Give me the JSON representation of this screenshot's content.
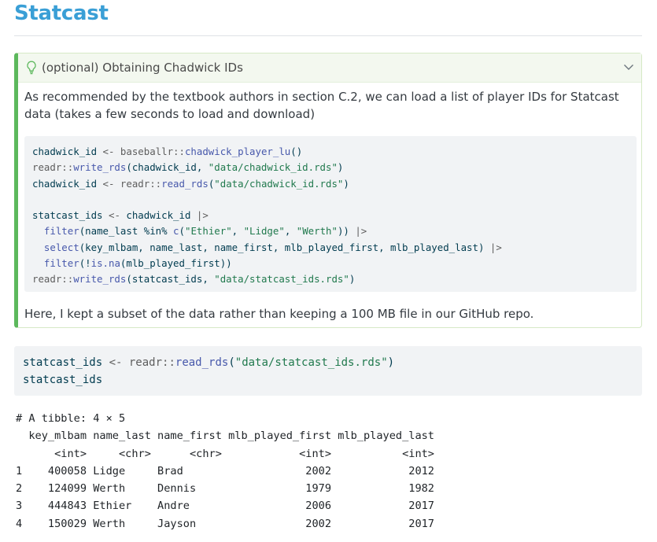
{
  "section_title": "Statcast",
  "callout": {
    "title": "(optional) Obtaining Chadwick IDs",
    "icon": "lightbulb-icon",
    "intro": "As recommended by the textbook authors in section C.2, we can load a list of player IDs for Statcast data (takes a few seconds to load and download)",
    "code": {
      "l1_var": "chadwick_id",
      "l1_op": " <- ",
      "l1_ns": "baseballr::",
      "l1_fn": "chadwick_player_lu",
      "l1_rest": "()",
      "l2_ns": "readr::",
      "l2_fn": "write_rds",
      "l2_args": "(chadwick_id, ",
      "l2_str": "\"data/chadwick_id.rds\"",
      "l2_end": ")",
      "l3_var": "chadwick_id",
      "l3_op": " <- ",
      "l3_ns": "readr::",
      "l3_fn": "read_rds",
      "l3_open": "(",
      "l3_str": "\"data/chadwick_id.rds\"",
      "l3_end": ")",
      "l5_var": "statcast_ids",
      "l5_op": " <- ",
      "l5_rest": "chadwick_id ",
      "l5_pipe": "|>",
      "l6_fn": "filter",
      "l6_args": "(name_last %in% ",
      "l6_fn2": "c",
      "l6_open": "(",
      "l6_s1": "\"Ethier\"",
      "l6_comma1": ", ",
      "l6_s2": "\"Lidge\"",
      "l6_comma2": ", ",
      "l6_s3": "\"Werth\"",
      "l6_end": ")) ",
      "l6_pipe": "|>",
      "l7_fn": "select",
      "l7_args": "(key_mlbam, name_last, name_first, mlb_played_first, mlb_played_last) ",
      "l7_pipe": "|>",
      "l8_fn": "filter",
      "l8_open": "(!",
      "l8_fn2": "is.na",
      "l8_rest": "(mlb_played_first))",
      "l9_ns": "readr::",
      "l9_fn": "write_rds",
      "l9_args": "(statcast_ids, ",
      "l9_str": "\"data/statcast_ids.rds\"",
      "l9_end": ")"
    },
    "note": "Here, I kept a subset of the data rather than keeping a 100 MB file in our GitHub repo."
  },
  "main_code": {
    "l1_var": "statcast_ids",
    "l1_op": " <- ",
    "l1_ns": "readr::",
    "l1_fn": "read_rds",
    "l1_open": "(",
    "l1_str": "\"data/statcast_ids.rds\"",
    "l1_end": ")",
    "l2": "statcast_ids"
  },
  "output": {
    "header": "# A tibble: 4 × 5",
    "columns": [
      "key_mlbam",
      "name_last",
      "name_first",
      "mlb_played_first",
      "mlb_played_last"
    ],
    "types": [
      "<int>",
      "<chr>",
      "<chr>",
      "<int>",
      "<int>"
    ],
    "rows": [
      [
        "1",
        "400058",
        "Lidge",
        "Brad",
        "2002",
        "2012"
      ],
      [
        "2",
        "124099",
        "Werth",
        "Dennis",
        "1979",
        "1982"
      ],
      [
        "3",
        "444843",
        "Ethier",
        "Andre",
        "2006",
        "2017"
      ],
      [
        "4",
        "150029",
        "Werth",
        "Jayson",
        "2002",
        "2017"
      ]
    ]
  }
}
